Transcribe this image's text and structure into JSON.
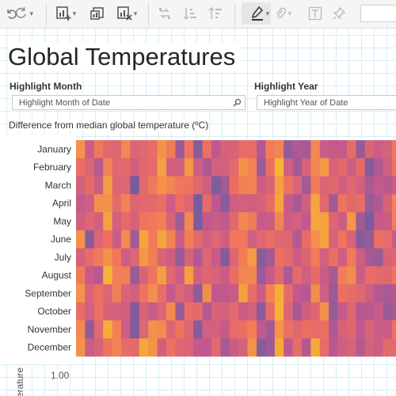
{
  "dashboard": {
    "title": "Global Temperatures",
    "filters": [
      {
        "label": "Highlight Month",
        "placeholder": "Highlight Month of Date"
      },
      {
        "label": "Highlight Year",
        "placeholder": "Highlight Year of Date"
      }
    ],
    "subtitle": "Difference from median global temperature (ºC)",
    "lower_axis_title": "erature",
    "lower_axis_tick": "1.00"
  },
  "toolbar": {
    "icons": [
      "undo-icon",
      "redo-icon",
      "new-worksheet-icon",
      "new-dashboard-icon",
      "clear-sheet-icon",
      "swap-icon",
      "sort-ascending-icon",
      "sort-descending-icon",
      "highlight-pen-icon",
      "paperclip-icon",
      "text-box-icon",
      "pin-icon"
    ]
  },
  "chart_data": {
    "type": "heatmap",
    "title": "",
    "rows": [
      "January",
      "February",
      "March",
      "April",
      "May",
      "June",
      "July",
      "August",
      "September",
      "October",
      "November",
      "December"
    ],
    "n_columns_visible": 36,
    "colors": {
      "cold": "#5b5fa5",
      "neutral": "#c2588e",
      "warm": "#ef7060",
      "hot": "#f7b533"
    },
    "grid": false
  }
}
